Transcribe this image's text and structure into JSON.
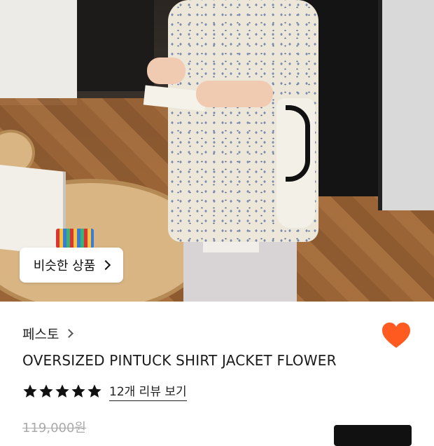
{
  "photo": {
    "similar_button_label": "비슷한 상품"
  },
  "product": {
    "brand": "페스토",
    "title": "OVERSIZED PINTUCK SHIRT JACKET FLOWER",
    "rating_stars": 5,
    "review_link": "12개 리뷰 보기",
    "original_price": "119,000원"
  },
  "colors": {
    "heart": "#ff5a1f",
    "star": "#111111",
    "buy_button": "#111111"
  }
}
